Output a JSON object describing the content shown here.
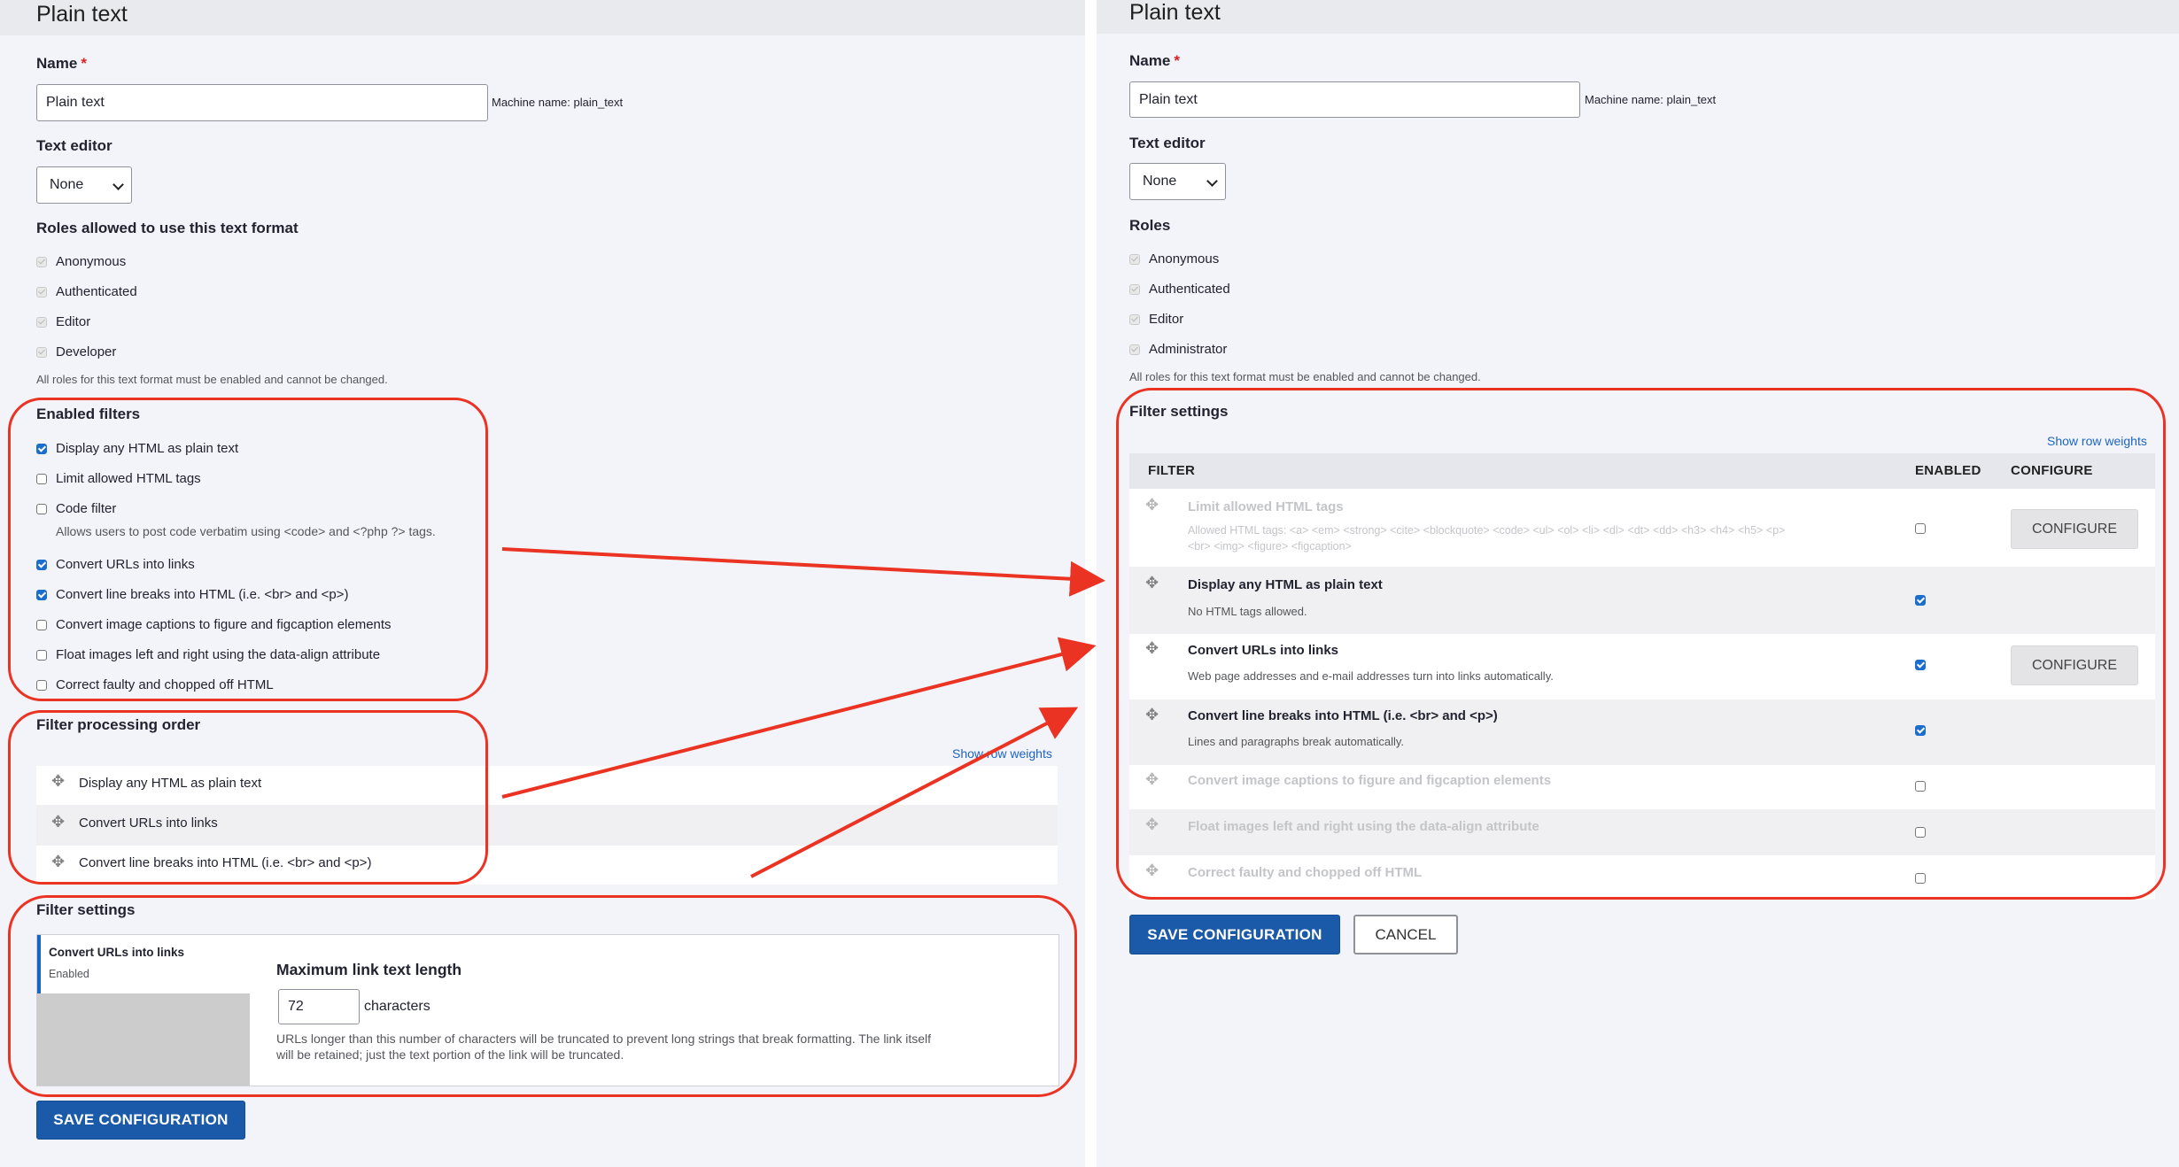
{
  "left": {
    "page_title": "Plain text",
    "name_label": "Name",
    "required_mark": "*",
    "name_value": "Plain text",
    "machine_name": "Machine name: plain_text",
    "text_editor_label": "Text editor",
    "text_editor_value": "None",
    "roles_heading": "Roles allowed to use this text format",
    "roles": [
      "Anonymous",
      "Authenticated",
      "Editor",
      "Developer"
    ],
    "roles_note": "All roles for this text format must be enabled and cannot be changed.",
    "enabled_filters_heading": "Enabled filters",
    "filters": [
      {
        "label": "Display any HTML as plain text",
        "checked": true
      },
      {
        "label": "Limit allowed HTML tags",
        "checked": false
      },
      {
        "label": "Code filter",
        "checked": false
      },
      {
        "label": "Convert URLs into links",
        "checked": true
      },
      {
        "label": "Convert line breaks into HTML (i.e. <br> and <p>)",
        "checked": true
      },
      {
        "label": "Convert image captions to figure and figcaption elements",
        "checked": false
      },
      {
        "label": "Float images left and right using the data-align attribute",
        "checked": false
      },
      {
        "label": "Correct faulty and chopped off HTML",
        "checked": false
      }
    ],
    "code_filter_desc": "Allows users to post code verbatim using <code> and <?php ?> tags.",
    "processing_heading": "Filter processing order",
    "show_row_weights": "Show row weights",
    "processing_rows": [
      "Display any HTML as plain text",
      "Convert URLs into links",
      "Convert line breaks into HTML (i.e. <br> and <p>)"
    ],
    "settings_heading": "Filter settings",
    "tab_title": "Convert URLs into links",
    "tab_status": "Enabled",
    "max_len_label": "Maximum link text length",
    "max_len_value": "72",
    "max_len_unit": "characters",
    "max_len_desc_1": "URLs longer than this number of characters will be truncated to prevent long strings that break formatting. The link itself",
    "max_len_desc_2": "will be retained; just the text portion of the link will be truncated.",
    "save_button": "SAVE CONFIGURATION"
  },
  "right": {
    "page_title": "Plain text",
    "name_label": "Name",
    "required_mark": "*",
    "name_value": "Plain text",
    "machine_name": "Machine name: plain_text",
    "text_editor_label": "Text editor",
    "text_editor_value": "None",
    "roles_heading": "Roles",
    "roles": [
      "Anonymous",
      "Authenticated",
      "Editor",
      "Administrator"
    ],
    "roles_note": "All roles for this text format must be enabled and cannot be changed.",
    "settings_heading": "Filter settings",
    "show_row_weights": "Show row weights",
    "col_filter": "FILTER",
    "col_enabled": "ENABLED",
    "col_configure": "CONFIGURE",
    "rows": [
      {
        "title": "Limit allowed HTML tags",
        "desc": "Allowed HTML tags: <a> <em> <strong> <cite> <blockquote> <code> <ul> <ol> <li> <dl> <dt> <dd> <h3> <h4> <h5> <p>",
        "desc2": "<br> <img> <figure> <figcaption>",
        "enabled": false,
        "configure": "CONFIGURE"
      },
      {
        "title": "Display any HTML as plain text",
        "desc": "No HTML tags allowed.",
        "enabled": true
      },
      {
        "title": "Convert URLs into links",
        "desc": "Web page addresses and e-mail addresses turn into links automatically.",
        "enabled": true,
        "configure": "CONFIGURE"
      },
      {
        "title": "Convert line breaks into HTML (i.e. <br> and <p>)",
        "desc": "Lines and paragraphs break automatically.",
        "enabled": true
      },
      {
        "title": "Convert image captions to figure and figcaption elements",
        "enabled": false
      },
      {
        "title": "Float images left and right using the data-align attribute",
        "enabled": false
      },
      {
        "title": "Correct faulty and chopped off HTML",
        "enabled": false
      }
    ],
    "save_button": "SAVE CONFIGURATION",
    "cancel_button": "CANCEL"
  },
  "colors": {
    "annotation_red": "#ea3323",
    "primary_blue": "#1a5aa8",
    "link_blue": "#1b64c2",
    "checkbox_blue": "#1b6ecb"
  },
  "icons": {
    "drag_handle": "move-cross-icon",
    "select_arrow": "chevron-down-icon"
  }
}
